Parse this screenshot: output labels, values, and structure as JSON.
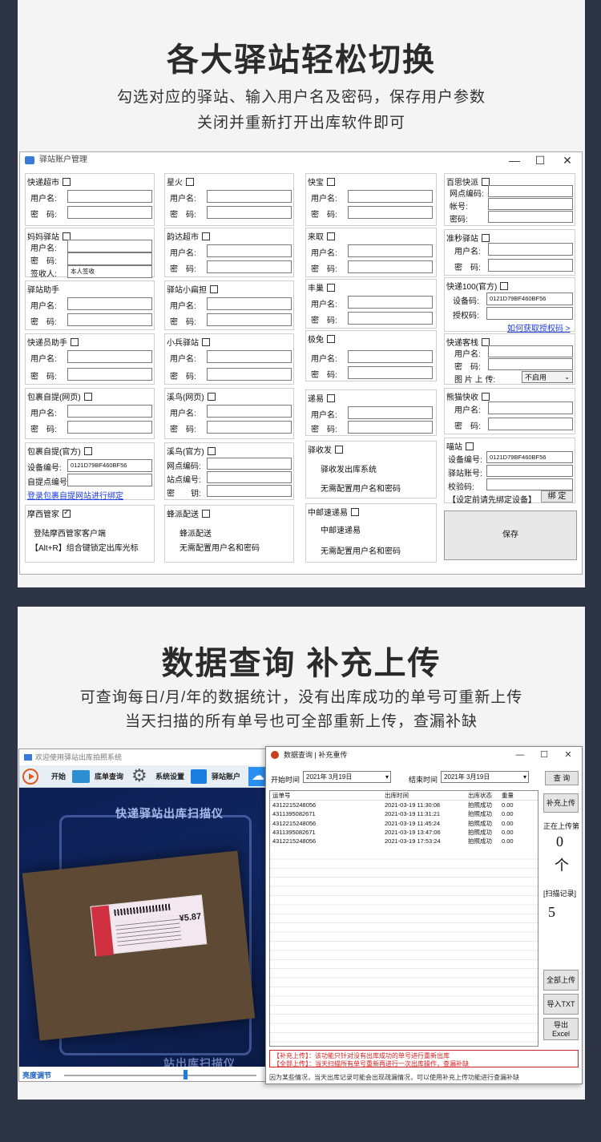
{
  "section1": {
    "heading": "各大驿站轻松切换",
    "subline1": "勾选对应的驿站、输入用户名及密码，保存用户参数",
    "subline2": "关闭并重新打开出库软件即可"
  },
  "account_window": {
    "title": "驿站账户管理",
    "controls": {
      "minimize": "—",
      "maximize": "☐",
      "close": "✕"
    },
    "labels": {
      "username": "用户名:",
      "password": "密　码:",
      "receiver": "签收人:",
      "device_code": "设备编号:",
      "pickup_code": "自提点编号",
      "site_code": "站点编号:",
      "secret": "密　　钥:",
      "network_code": "网点编码:",
      "account": "帐号:",
      "pwd_short": "密码:",
      "device_code2": "设备码:",
      "auth_code": "授权码:",
      "image_upload": "图 片 上 传:",
      "station_account": "驿站账号:",
      "verify_code": "校验码:"
    },
    "groups": {
      "kuaidi_chaoshi": "快递超市",
      "xinghuo": "星火",
      "kuaibao": "快宝",
      "baisi_kuaipai": "百思快派",
      "mama_yizhan": "妈妈驿站",
      "yunda_chaoshi": "韵达超市",
      "laiqu": "来取",
      "zhunmiao_yizhan": "准秒驿站",
      "yizhan_zhushou": "驿站助手",
      "yizhan_xiaobiandan": "驿站小扁担",
      "fengchao": "丰巢",
      "kuaidi100": "快递100(官方)",
      "kuaidiyuan_zhushou": "快递员助手",
      "xiaobing_yizhan": "小兵驿站",
      "jitu": "极兔",
      "kuaidi_kezhan": "快递客栈",
      "baoguo_ziti_web": "包裹自提(网页)",
      "xiniao_web": "溪鸟(网页)",
      "diyi": "递易",
      "xiongmao_kuaishou": "熊猫快收",
      "baoguo_ziti_official": "包裹自提(官方)",
      "xiniao_official": "溪鸟(官方)",
      "yishoufa": "驿收发",
      "miaozhan": "喵站",
      "moxi_guanjia": "摩西管家",
      "fengpai_peisong": "蜂派配送",
      "youzheng_sudiyi": "中邮速递易"
    },
    "values": {
      "mama_receiver": "本人签收",
      "kuaidi100_device": "0121D79BF460BF56",
      "baoguo_device": "0121D79BF460BF56",
      "miaozhan_device": "0121D79BF460BF56",
      "image_upload_option": "不启用"
    },
    "links": {
      "kuaidi100_auth": "如何获取授权码 >",
      "baoguo_bind": "登录包裹自提网站进行绑定"
    },
    "notes": {
      "moxi1": "登陆摩西管家客户端",
      "moxi2": "【Alt+R】组合键锁定出库光标",
      "fengpai1": "蜂派配送",
      "fengpai2": "无需配置用户名和密码",
      "yishoufa1": "驿收发出库系统",
      "yishoufa2": "无需配置用户名和密码",
      "youzheng1": "中邮速递易",
      "youzheng2": "无需配置用户名和密码",
      "miaozhan_tip": "【设定前请先绑定设备】"
    },
    "buttons": {
      "bind": "绑 定",
      "save": "保存"
    }
  },
  "section2": {
    "heading": "数据查询 补充上传",
    "subline1": "可查询每日/月/年的数据统计，没有出库成功的单号可重新上传",
    "subline2": "当天扫描的所有单号也可全部重新上传，查漏补缺"
  },
  "scanner_window": {
    "title": "欢迎使用驿站出库拍照系统",
    "toolbar": [
      "开始",
      "底单查询",
      "系统设置",
      "驿站账户"
    ],
    "overlay_title": "快递驿站出库扫描仪",
    "overlay_bottom": "站出库扫描仪",
    "label_price": "¥5.87",
    "brightness_label": "亮度调节",
    "brightness_value": 0.62
  },
  "query_window": {
    "title": "数据查询 | 补充重传",
    "controls": {
      "minimize": "—",
      "maximize": "☐",
      "close": "✕"
    },
    "start_label": "开始时间",
    "start_date": "2021年 3月19日",
    "end_label": "结束时间",
    "end_date": "2021年 3月19日",
    "buttons": {
      "query": "查 询",
      "resupply": "补充上传",
      "upload_all": "全部上传",
      "import_txt": "导入TXT",
      "export1": "导出",
      "export2": "Excel"
    },
    "uploading_label": "正在上传第",
    "uploading_count": "0",
    "uploading_unit": "个",
    "scan_label": "[扫描记录]",
    "scan_count": "5",
    "columns": [
      "运单号",
      "出库时间",
      "出库状态",
      "重量"
    ],
    "rows": [
      [
        "4312215248056",
        "2021-03-19 11:30:08",
        "拍照成功",
        "0.00"
      ],
      [
        "4311395082671",
        "2021-03-19 11:31:21",
        "拍照成功",
        "0.00"
      ],
      [
        "4312215248056",
        "2021-03-19 11:45:24",
        "拍照成功",
        "0.00"
      ],
      [
        "4311395082671",
        "2021-03-19 13:47:06",
        "拍照成功",
        "0.00"
      ],
      [
        "4312215248056",
        "2021-03-19 17:53:24",
        "拍照成功",
        "0.00"
      ]
    ],
    "hint1": "【补充上传】：该功能只针对没有出库成功的单号进行重新出库",
    "hint2": "【全部上传】：当天扫描所有单号重新再进行一次出库操作，查漏补缺",
    "footer": "因为某些情况，当天出库记录可能会出现疏漏情况，可以使用补充上传功能进行查漏补缺"
  },
  "colors": {
    "background": "#2c3446",
    "panel": "#f4f4f4",
    "link": "#1e3cdc",
    "hint": "#d42020",
    "accent": "#1a7fe0"
  }
}
